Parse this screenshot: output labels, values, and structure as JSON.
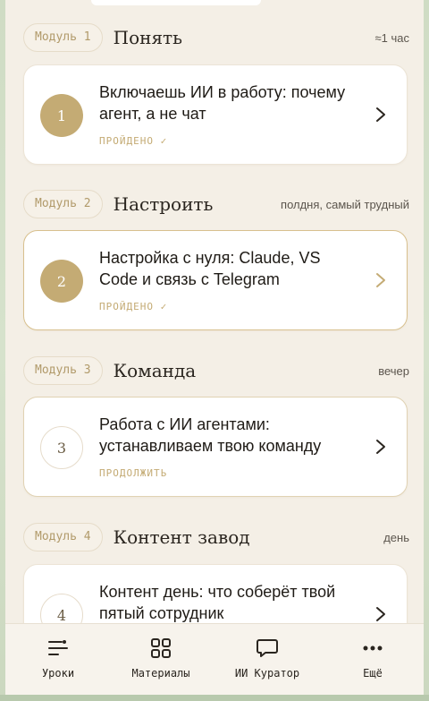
{
  "modules": [
    {
      "badge": "Модуль 1",
      "title": "Понять",
      "meta": "≈1 час",
      "lesson": {
        "number": "1",
        "title": "Включаешь ИИ в работу: почему агент, а не чат",
        "status": "ПРОЙДЕНО ✓",
        "state": "done"
      }
    },
    {
      "badge": "Модуль 2",
      "title": "Настроить",
      "meta": "полдня, самый трудный",
      "lesson": {
        "number": "2",
        "title": "Настройка с нуля: Claude, VS Code и связь с Telegram",
        "status": "ПРОЙДЕНО ✓",
        "state": "done"
      }
    },
    {
      "badge": "Модуль 3",
      "title": "Команда",
      "meta": "вечер",
      "lesson": {
        "number": "3",
        "title": "Работа с ИИ агентами: устанавливаем твою команду",
        "status": "ПРОДОЛЖИТЬ",
        "state": "open"
      }
    },
    {
      "badge": "Модуль 4",
      "title": "Контент завод",
      "meta": "день",
      "lesson": {
        "number": "4",
        "title": "Контент день: что соберёт твой пятый сотрудник",
        "status": "",
        "state": "open"
      }
    }
  ],
  "tabs": [
    {
      "label": "Уроки",
      "icon": "lessons-icon"
    },
    {
      "label": "Материалы",
      "icon": "grid-icon"
    },
    {
      "label": "ИИ Куратор",
      "icon": "chat-icon"
    },
    {
      "label": "Ещё",
      "icon": "more-icon"
    }
  ],
  "colors": {
    "accent_gold": "#c4ab74",
    "background": "#f4efe6",
    "text_dark": "#1f1b16"
  }
}
